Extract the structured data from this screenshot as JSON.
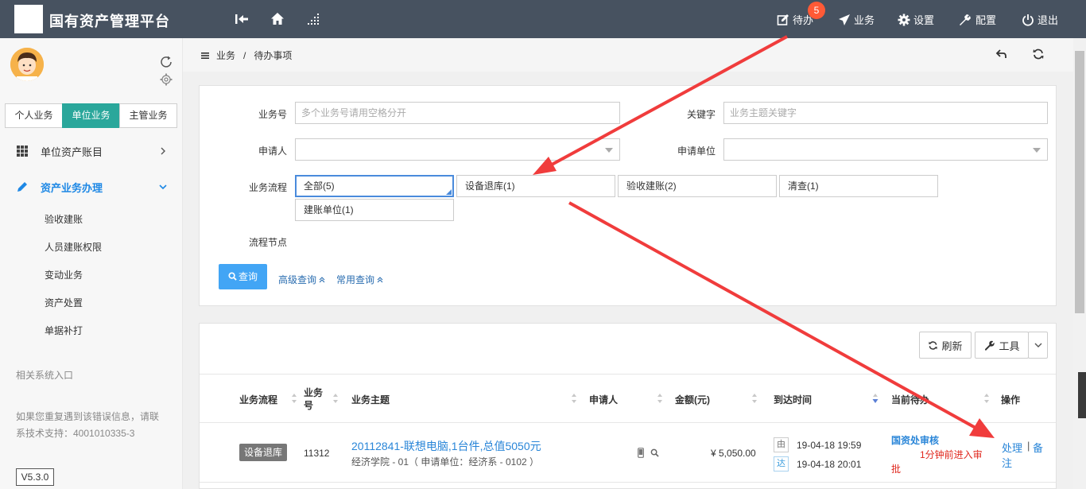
{
  "header": {
    "title": "国有资产管理平台",
    "todo_label": "待办",
    "todo_count": "5",
    "business_label": "业务",
    "settings_label": "设置",
    "config_label": "配置",
    "logout_label": "退出"
  },
  "sidebar": {
    "tabs": [
      "个人业务",
      "单位业务",
      "主管业务"
    ],
    "active_tab": "单位业务",
    "nav": [
      {
        "label": "单位资产账目",
        "icon": "grid-icon"
      },
      {
        "label": "资产业务办理",
        "icon": "pencil-icon",
        "active": true
      }
    ],
    "subnav": [
      "验收建账",
      "人员建账权限",
      "变动业务",
      "资产处置",
      "单据补打"
    ],
    "related_label": "相关系统入口",
    "support_line1": "如果您重复遇到该错误信息，请联",
    "support_line2": "系技术支持：4001010335-3",
    "version": "V5.3.0"
  },
  "breadcrumb": {
    "root": "业务",
    "separator": "/",
    "current": "待办事项"
  },
  "filter": {
    "business_no_label": "业务号",
    "business_no_placeholder": "多个业务号请用空格分开",
    "keyword_label": "关键字",
    "keyword_placeholder": "业务主题关键字",
    "applicant_label": "申请人",
    "applicant_value": "",
    "unit_label": "申请单位",
    "unit_value": "",
    "flow_label": "业务流程",
    "flows": [
      "全部(5)",
      "设备退库(1)",
      "验收建账(2)",
      "清查(1)",
      "建账单位(1)"
    ],
    "selected_flow": "全部(5)",
    "node_label": "流程节点",
    "query_button": "查询",
    "advanced_query": "高级查询",
    "common_query": "常用查询"
  },
  "toolbar": {
    "refresh_label": "刷新",
    "tools_label": "工具"
  },
  "table": {
    "columns": [
      "业务流程",
      "业务号",
      "业务主题",
      "申请人",
      "金额(元)",
      "到达时间",
      "当前待办",
      "操作"
    ],
    "rows": [
      {
        "flow_tag": "设备退库",
        "business_no": "11312",
        "subject": "20112841-联想电脑,1台件,总值5050元",
        "subject_detail": "经济学院 - 01（ 申请单位：经济系 - 0102 ）",
        "amount": "¥ 5,050.00",
        "from_label": "由",
        "from_time": "19-04-18 19:59",
        "arrive_label": "达",
        "arrive_time": "19-04-18 20:01",
        "current_node": "国资处审核",
        "time_note": "1分钟前进入审",
        "time_note_2": "批",
        "action_process": "处理",
        "action_sep": "|",
        "action_note": "备",
        "action_note_2": "注"
      }
    ]
  },
  "colors": {
    "topbar": "#475260",
    "accent_tab": "#2aa79b",
    "primary": "#42a5f5",
    "link": "#2a86d8",
    "arrow": "#f03c3c",
    "badge": "#ff5a36"
  }
}
